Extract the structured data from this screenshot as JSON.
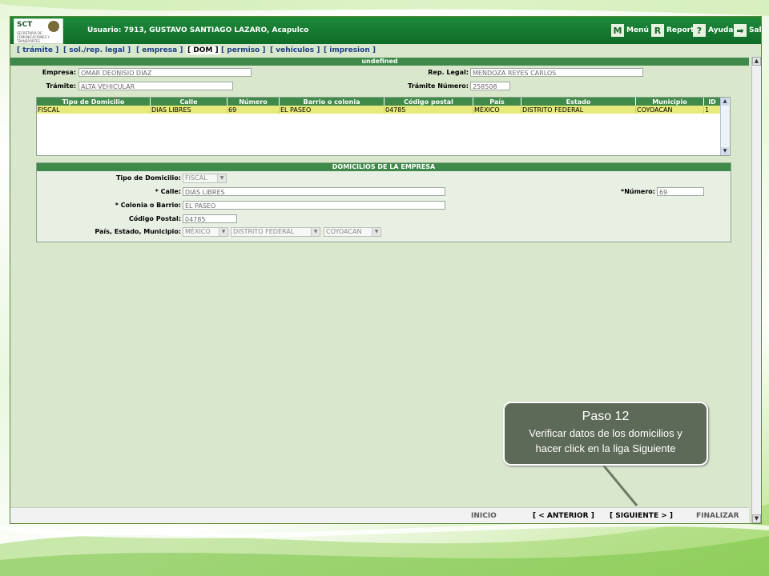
{
  "topbar": {
    "logo_text": "SCT",
    "logo_sub": "SECRETARÍA DE COMUNICACIONES Y TRANSPORTES",
    "user": "Usuario: 7913, GUSTAVO SANTIAGO LAZARO, Acapulco",
    "menu": {
      "icon": "M",
      "label": "Menú"
    },
    "report": {
      "icon": "R",
      "label": "Reporte"
    },
    "help": {
      "icon": "?",
      "label": "Ayuda"
    },
    "exit": {
      "icon": "➡",
      "label": "Salir"
    }
  },
  "tabs": [
    "[ trámite ]",
    "[ sol./rep. legal ]",
    "[ empresa ]",
    "[ DOM ]",
    "[ permiso ]",
    "[ vehículos ]",
    "[ impresion ]"
  ],
  "active_tab": "[ DOM ]",
  "section_title": "undefined",
  "header_form": {
    "empresa_label": "Empresa:",
    "empresa_value": "OMAR DEONISIO DIAZ",
    "rep_legal_label": "Rep. Legal:",
    "rep_legal_value": "MENDOZA REYES CARLOS",
    "tramite_label": "Trámite:",
    "tramite_value": "ALTA VEHICULAR",
    "tramite_numero_label": "Trámite Número:",
    "tramite_numero_value": "258508"
  },
  "grid": {
    "columns": [
      "Tipo de Domicilio",
      "Calle",
      "Número",
      "Barrio o colonia",
      "Código postal",
      "País",
      "Estado",
      "Municipio",
      "ID"
    ],
    "rows": [
      [
        "FISCAL",
        "DIAS LIBRES",
        "69",
        "EL PASEO",
        "04785",
        "MÉXICO",
        "DISTRITO FEDERAL",
        "COYOACAN",
        "1"
      ]
    ]
  },
  "domicilios": {
    "title": "DOMICILIOS DE LA EMPRESA",
    "tipo_label": "Tipo de Domicilio:",
    "tipo_value": "FISCAL",
    "calle_label": "* Calle:",
    "calle_value": "DIAS LIBRES",
    "numero_label": "*Número:",
    "numero_value": "69",
    "colonia_label": "* Colonia o Barrio:",
    "colonia_value": "EL PASEO",
    "cp_label": "Código Postal:",
    "cp_value": "04785",
    "pais_label": "País, Estado, Municipio:",
    "pais_value": "MÉXICO",
    "estado_value": "DISTRITO FEDERAL",
    "municipio_value": "COYOACAN"
  },
  "bottom_nav": {
    "inicio": "INICIO",
    "anterior": "[ < ANTERIOR ]",
    "siguiente": "[ SIGUIENTE > ]",
    "finalizar": "FINALIZAR"
  },
  "callout": {
    "title": "Paso 12",
    "body_line1": "Verificar datos de los domicilios y",
    "body_line2": "hacer click en la liga Siguiente"
  },
  "colors": {
    "topbar": "#1e8a3b",
    "header_green": "#3f8a4a",
    "highlight_row": "#e7ea7a",
    "callout_bg": "#5d6a58"
  }
}
